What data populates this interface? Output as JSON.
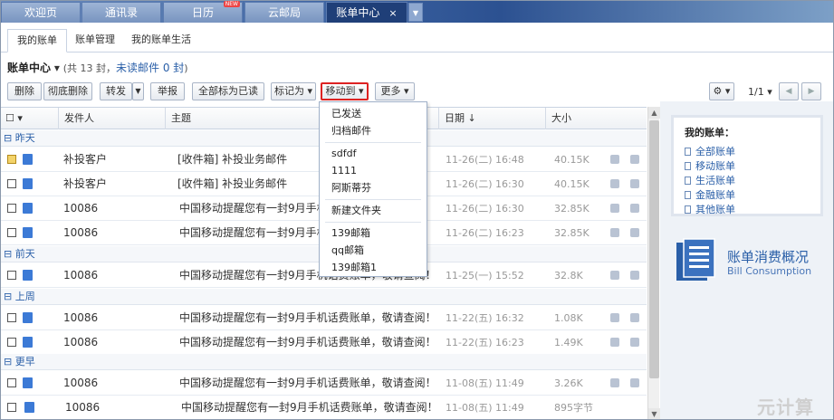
{
  "tabs": [
    {
      "label": "欢迎页"
    },
    {
      "label": "通讯录"
    },
    {
      "label": "日历",
      "badge": "NEW"
    },
    {
      "label": "云邮局"
    },
    {
      "label": "账单中心",
      "close": "×"
    }
  ],
  "subtabs": [
    "我的账单",
    "账单管理",
    "我的账单生活"
  ],
  "header": {
    "title": "账单中心",
    "caret": "▾",
    "count": "(共 13 封，",
    "unread": "未读邮件 0 封",
    "tail": ")"
  },
  "toolbar": {
    "delete": "删除",
    "perm_delete": "彻底删除",
    "forward": "转发",
    "report": "举报",
    "mark_all_read": "全部标为已读",
    "mark_as": "标记为 ▾",
    "move_to": "移动到 ▾",
    "more": "更多 ▾",
    "settings": "⚙ ▾",
    "page": "1/1 ▾",
    "prev": "◀",
    "next": "▶"
  },
  "columns": {
    "check": "☐ ▾",
    "sender": "发件人",
    "subject": "主题",
    "date": "日期 ↓",
    "size": "大小"
  },
  "groups": [
    "昨天",
    "前天",
    "上周",
    "更早"
  ],
  "rows": [
    {
      "sender": "补投客户",
      "subject": "[收件箱] 补投业务邮件",
      "date": "11-26(二) 16:48",
      "size": "40.15K",
      "checked": true
    },
    {
      "sender": "补投客户",
      "subject": "[收件箱] 补投业务邮件",
      "date": "11-26(二) 16:30",
      "size": "40.15K",
      "checked": false
    },
    {
      "sender": "10086",
      "subject": "中国移动提醒您有一封9月手机",
      "date": "11-26(二) 16:30",
      "size": "32.85K",
      "checked": false
    },
    {
      "sender": "10086",
      "subject": "中国移动提醒您有一封9月手机",
      "date": "11-26(二) 16:23",
      "size": "32.85K",
      "checked": false
    },
    {
      "sender": "10086",
      "subject": "中国移动提醒您有一封9月手机话费账单，敬请查阅！",
      "date": "11-25(一) 15:52",
      "size": "32.8K",
      "checked": false
    },
    {
      "sender": "10086",
      "subject": "中国移动提醒您有一封9月手机话费账单，敬请查阅！",
      "date": "11-22(五) 16:32",
      "size": "1.08K",
      "checked": false
    },
    {
      "sender": "10086",
      "subject": "中国移动提醒您有一封9月手机话费账单，敬请查阅！",
      "date": "11-22(五) 16:23",
      "size": "1.49K",
      "checked": false
    },
    {
      "sender": "10086",
      "subject": "中国移动提醒您有一封9月手机话费账单，敬请查阅！",
      "date": "11-08(五) 11:49",
      "size": "3.26K",
      "checked": false
    },
    {
      "sender": "10086",
      "subject": "中国移动提醒您有一封9月手机话费账单，敬请查阅！",
      "date": "11-08(五) 11:49",
      "size": "895字节",
      "checked": false
    }
  ],
  "menu": [
    "已发送",
    "归档邮件",
    "sdfdf",
    "1111",
    "阿斯蒂芬",
    "新建文件夹",
    "139邮箱",
    "qq邮箱",
    "139邮箱1"
  ],
  "sidebar": {
    "title": "我的账单：",
    "items": [
      "全部账单",
      "移动账单",
      "生活账单",
      "金融账单",
      "其他账单"
    ],
    "banner_cn": "账单消费概况",
    "banner_en": "Bill Consumption"
  },
  "watermark": "元计算",
  "colors": {
    "accent": "#2a5fa8",
    "tabbar": "#2c5191",
    "highlight": "#d22222"
  }
}
